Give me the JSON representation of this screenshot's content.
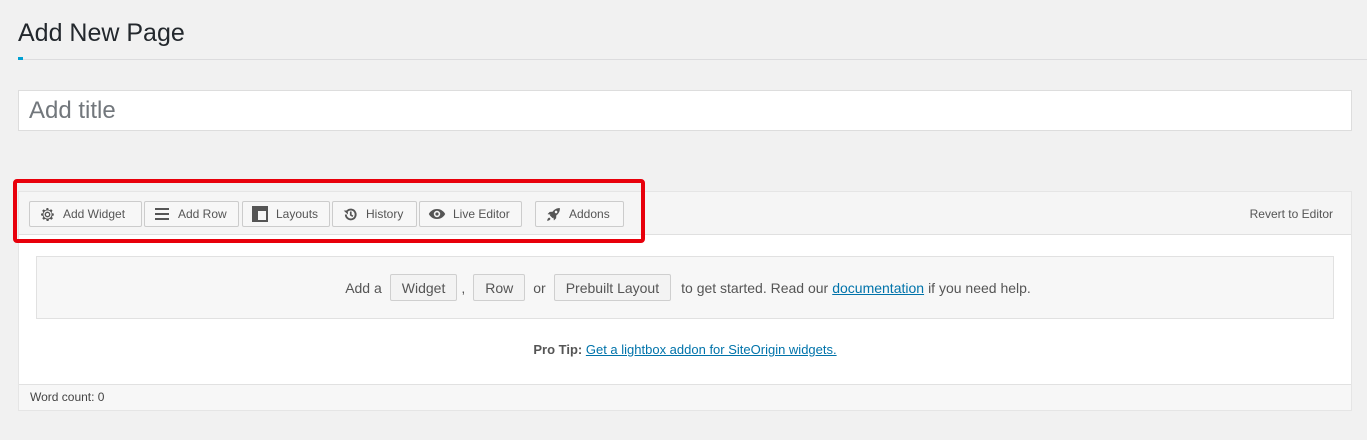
{
  "page": {
    "title": "Add New Page",
    "title_placeholder": "Add title"
  },
  "toolbar": {
    "buttons": [
      {
        "label": "Add Widget",
        "icon": "gear-icon"
      },
      {
        "label": "Add Row",
        "icon": "rows-icon"
      },
      {
        "label": "Layouts",
        "icon": "layout-icon"
      },
      {
        "label": "History",
        "icon": "history-icon"
      },
      {
        "label": "Live Editor",
        "icon": "eye-icon"
      },
      {
        "label": "Addons",
        "icon": "rocket-icon"
      }
    ],
    "revert_label": "Revert to Editor"
  },
  "empty_state": {
    "prefix": "Add a",
    "widget_label": "Widget",
    "comma": ",",
    "row_label": "Row",
    "or": "or",
    "prebuilt_label": "Prebuilt Layout",
    "middle": "to get started. Read our",
    "doc_link": "documentation",
    "suffix": "if you need help."
  },
  "pro_tip": {
    "label": "Pro Tip:",
    "link": "Get a lightbox addon for SiteOrigin widgets."
  },
  "status": {
    "word_count": "Word count: 0"
  },
  "colors": {
    "accent": "#00a0d2",
    "link": "#0073aa",
    "highlight": "#e8000b"
  }
}
